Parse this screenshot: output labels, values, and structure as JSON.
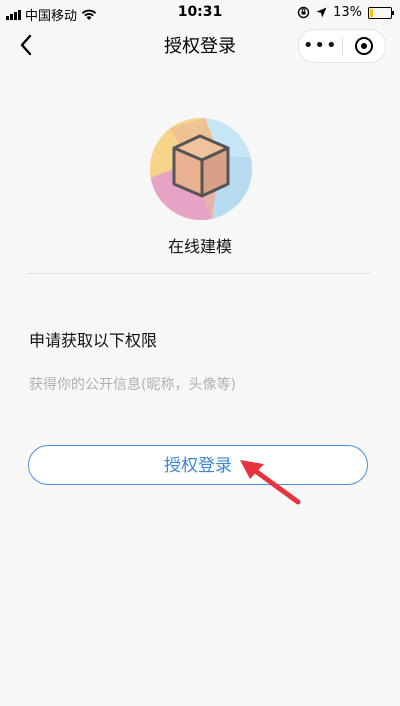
{
  "status_bar": {
    "carrier": "中国移动",
    "time": "10:31",
    "battery": "13%",
    "battery_level": 0.13
  },
  "nav": {
    "title": "授权登录",
    "more_label": "•••"
  },
  "app": {
    "name": "在线建模"
  },
  "permissions": {
    "title": "申请获取以下权限",
    "description": "获得你的公开信息(昵称，头像等)"
  },
  "auth_button": {
    "label": "授权登录"
  },
  "colors": {
    "accent": "#3a86d8",
    "arrow": "#e8323c",
    "battery": "#f4c400"
  }
}
